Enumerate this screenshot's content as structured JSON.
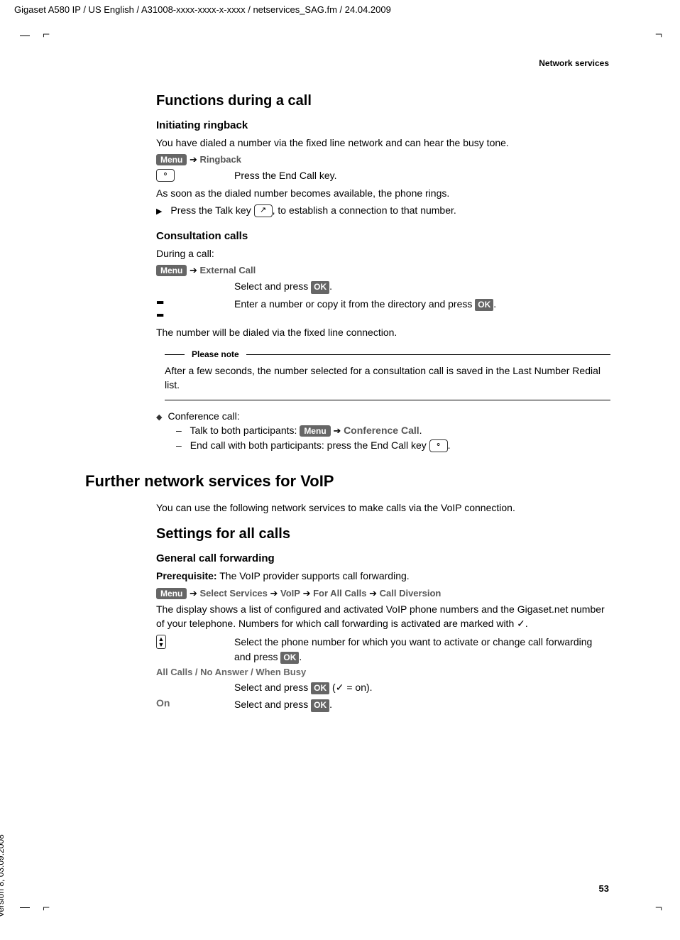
{
  "header_line": "Gigaset A580 IP / US English / A31008-xxxx-xxxx-x-xxxx / netservices_SAG.fm / 24.04.2009",
  "page_header": "Network services",
  "page_number": "53",
  "version_text": "Version 8, 03.09.2008",
  "ui": {
    "menu": "Menu",
    "ok": "OK"
  },
  "s1": {
    "title": "Functions during a call",
    "sub1": {
      "title": "Initiating ringback",
      "text1": "You have dialed a number via the fixed line network and can hear the busy tone.",
      "menu_path": "Ringback",
      "end_call_text": "Press the End Call key.",
      "text2": "As soon as the dialed number becomes available, the phone rings.",
      "bullet1": "Press the Talk key ",
      "bullet1_end": ", to establish a connection to that number."
    },
    "sub2": {
      "title": "Consultation calls",
      "text1": "During a call:",
      "menu_path": "External Call",
      "select_text": "Select and press ",
      "enter_num_text": "Enter a number or copy it from the directory and press ",
      "text2": "The number will be dialed via the fixed line connection."
    },
    "note": {
      "label": "Please note",
      "text": "After a few seconds, the number selected for a consultation call is saved in the Last Number Redial list."
    },
    "conf": {
      "item": "Conference call:",
      "dash1_a": "Talk to both participants: ",
      "dash1_path": "Conference Call",
      "dash2_a": "End call with both participants: press the End Call key "
    }
  },
  "s2": {
    "title": "Further network services for VoIP",
    "intro": "You can use the following network services to make calls via the VoIP connection."
  },
  "s3": {
    "title": "Settings for all calls",
    "sub1": {
      "title": "General call forwarding",
      "prereq_label": "Prerequisite:",
      "prereq_text": " The VoIP provider supports call forwarding.",
      "mp": {
        "a": "Select Services",
        "b": "VoIP",
        "c": "For All Calls",
        "d": "Call Diversion"
      },
      "text1": "The display shows a list of configured and activated VoIP phone numbers and the Gigaset.net number of your telephone. Numbers for which call forwarding is activated are marked with ",
      "select_phone": "Select the phone number for which you want to activate or change call forwarding and press ",
      "modes": "All Calls / No Answer / When Busy",
      "modes_text": "Select and press ",
      "modes_on": " = on).",
      "on_label": "On",
      "on_text": "Select and press "
    }
  }
}
